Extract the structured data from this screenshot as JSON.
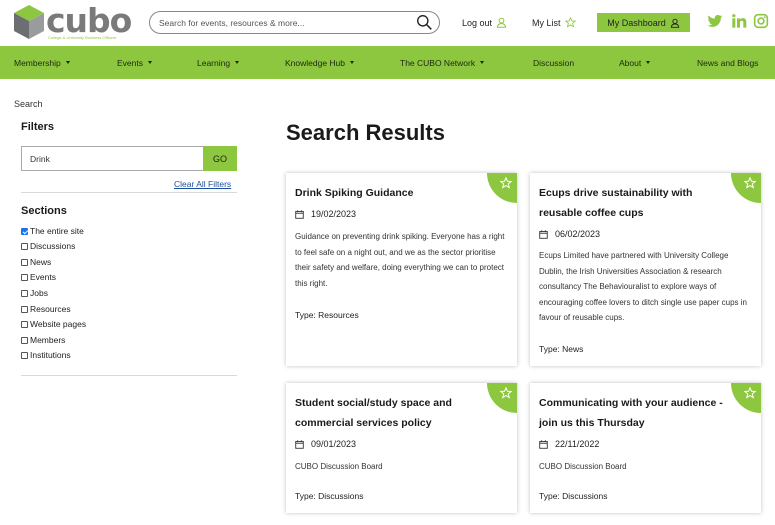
{
  "header": {
    "logo_text": "cubo",
    "logo_tagline": "College & University Business Officers",
    "search_placeholder": "Search for events, resources & more...",
    "logout_label": "Log out",
    "mylist_label": "My List",
    "dashboard_label": "My Dashboard"
  },
  "nav": {
    "items": [
      {
        "label": "Membership",
        "has_dropdown": true
      },
      {
        "label": "Events",
        "has_dropdown": true
      },
      {
        "label": "Learning",
        "has_dropdown": true
      },
      {
        "label": "Knowledge Hub",
        "has_dropdown": true
      },
      {
        "label": "The CUBO Network",
        "has_dropdown": true
      },
      {
        "label": "Discussion",
        "has_dropdown": false
      },
      {
        "label": "About",
        "has_dropdown": true
      },
      {
        "label": "News and Blogs",
        "has_dropdown": false
      }
    ]
  },
  "breadcrumb": "Search",
  "sidebar": {
    "filters_title": "Filters",
    "filter_value": "Drink",
    "go_label": "GO",
    "clear_label": "Clear All Filters",
    "sections_title": "Sections",
    "sections": [
      {
        "label": "The entire site",
        "checked": true
      },
      {
        "label": "Discussions",
        "checked": false
      },
      {
        "label": "News",
        "checked": false
      },
      {
        "label": "Events",
        "checked": false
      },
      {
        "label": "Jobs",
        "checked": false
      },
      {
        "label": "Resources",
        "checked": false
      },
      {
        "label": "Website pages",
        "checked": false
      },
      {
        "label": "Members",
        "checked": false
      },
      {
        "label": "Institutions",
        "checked": false
      }
    ]
  },
  "results": {
    "title": "Search Results",
    "cards": [
      {
        "title": "Drink Spiking Guidance",
        "date": "19/02/2023",
        "description": "Guidance on preventing drink spiking. Everyone has a right to feel safe on a night out, and we as the sector prioritise their safety and welfare, doing everything we can to protect this right.",
        "type": "Type: Resources"
      },
      {
        "title": "Ecups drive sustainability with reusable coffee cups",
        "date": "06/02/2023",
        "description": "Ecups Limited have partnered with University College Dublin, the Irish Universities Association & research consultancy The Behaviouralist to explore ways of encouraging coffee lovers to ditch single use paper cups in favour of reusable cups.",
        "type": "Type: News"
      },
      {
        "title": "Student social/study space and commercial services policy",
        "date": "09/01/2023",
        "description": "CUBO Discussion Board",
        "type": "Type: Discussions"
      },
      {
        "title": "Communicating with your audience - join us this Thursday",
        "date": "22/11/2022",
        "description": "CUBO Discussion Board",
        "type": "Type: Discussions"
      }
    ]
  },
  "colors": {
    "accent": "#8dc63f",
    "link": "#1b4f9c",
    "logo_grey": "#7a7a7a"
  }
}
